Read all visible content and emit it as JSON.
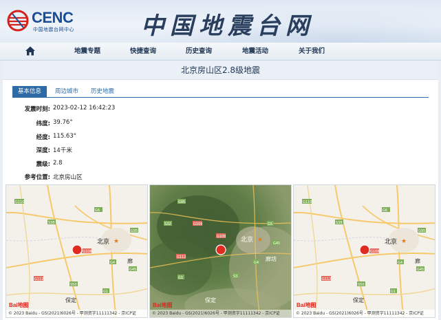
{
  "header": {
    "logo_text": "CENC",
    "logo_sub": "中国地震台网中心",
    "site_title": "中国地震台网"
  },
  "nav": {
    "home_icon": "home-icon",
    "items": [
      {
        "label": "地震专题"
      },
      {
        "label": "快捷查询"
      },
      {
        "label": "历史查询"
      },
      {
        "label": "地震活动"
      },
      {
        "label": "关于我们"
      }
    ]
  },
  "event": {
    "title": "北京房山区2.8级地震"
  },
  "tabs": [
    {
      "label": "基本信息",
      "active": true
    },
    {
      "label": "周边城市",
      "active": false
    },
    {
      "label": "历史地震",
      "active": false
    }
  ],
  "info": [
    {
      "label": "发震时刻:",
      "value": "2023-02-12 16:42:23"
    },
    {
      "label": "纬度:",
      "value": "39.76°"
    },
    {
      "label": "经度:",
      "value": "115.63°"
    },
    {
      "label": "深度:",
      "value": "14千米"
    },
    {
      "label": "震级:",
      "value": "2.8"
    },
    {
      "label": "参考位置:",
      "value": "北京房山区"
    }
  ],
  "maps": [
    {
      "kind": "road",
      "city_label": "北京",
      "other_labels": [
        "廊",
        "保定"
      ],
      "road_labels": [
        "G110",
        "G6",
        "S38",
        "G95",
        "G108",
        "G4",
        "G45",
        "G112",
        "S50",
        "G1"
      ],
      "baidu": "Bai地图",
      "copyright": "© 2023 Baidu - GS(2021)6026号 - 甲测资字11111342 - 京ICP证"
    },
    {
      "kind": "satellite",
      "city_label": "北京",
      "other_labels": [
        "廊坊",
        "保定"
      ],
      "road_labels": [
        "G95",
        "S32",
        "G109",
        "G108",
        "G5",
        "G4",
        "G45",
        "G112",
        "S3",
        "G1"
      ],
      "baidu": "Bai地图",
      "copyright": "© 2023 Baidu - GS(2021)6026号 - 甲测资字11111342 - 京ICP证"
    },
    {
      "kind": "road",
      "city_label": "北京",
      "other_labels": [
        "廊",
        "保定"
      ],
      "road_labels": [
        "G110",
        "G6",
        "S38",
        "G95",
        "G108",
        "G4",
        "G45",
        "G112",
        "S50",
        "G1"
      ],
      "baidu": "Bai地图",
      "copyright": "© 2023 Baidu - GS(2021)6026号 - 甲测资字11111342 - 京ICP证"
    }
  ],
  "colors": {
    "accent": "#2d6aa6",
    "epicenter": "#e02b20",
    "title_text": "#1f3552"
  }
}
